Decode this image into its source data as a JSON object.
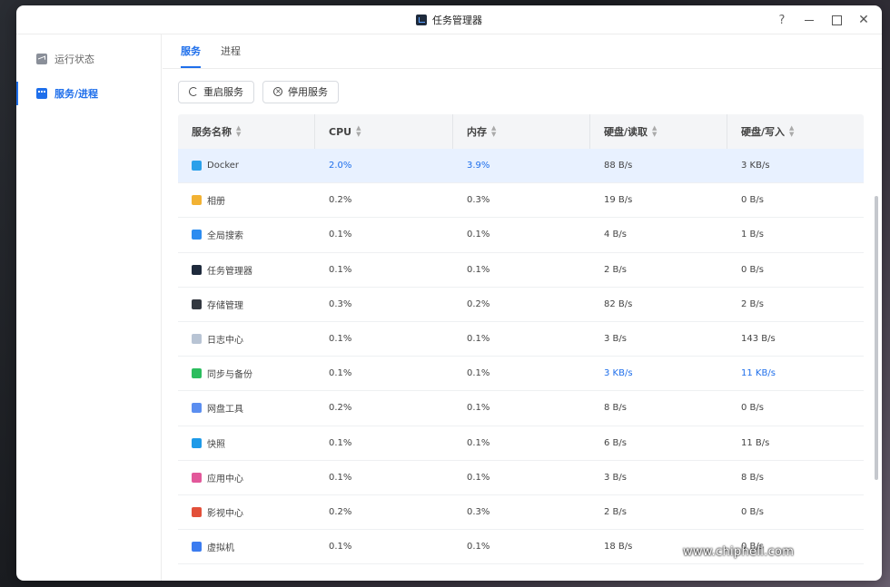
{
  "window": {
    "title": "任务管理器",
    "help": "?",
    "close_glyph": "✕"
  },
  "sidebar": {
    "items": [
      {
        "label": "运行状态",
        "active": false
      },
      {
        "label": "服务/进程",
        "active": true
      }
    ]
  },
  "tabs": [
    {
      "label": "服务",
      "active": true
    },
    {
      "label": "进程",
      "active": false
    }
  ],
  "toolbar": {
    "restart_label": "重启服务",
    "stop_label": "停用服务"
  },
  "table": {
    "columns": [
      "服务名称",
      "CPU",
      "内存",
      "硬盘/读取",
      "硬盘/写入"
    ],
    "rows": [
      {
        "icon": "docker-icon",
        "color": "#2aa0ea",
        "name": "Docker",
        "cpu": "2.0%",
        "mem": "3.9%",
        "read": "88 B/s",
        "write": "3 KB/s",
        "selected": true
      },
      {
        "icon": "photos-icon",
        "color": "#f2b233",
        "name": "相册",
        "cpu": "0.2%",
        "mem": "0.3%",
        "read": "19 B/s",
        "write": "0 B/s"
      },
      {
        "icon": "search-icon",
        "color": "#2c8cf0",
        "name": "全局搜索",
        "cpu": "0.1%",
        "mem": "0.1%",
        "read": "4 B/s",
        "write": "1 B/s"
      },
      {
        "icon": "task-manager-icon",
        "color": "#1e2a3c",
        "name": "任务管理器",
        "cpu": "0.1%",
        "mem": "0.1%",
        "read": "2 B/s",
        "write": "0 B/s"
      },
      {
        "icon": "storage-icon",
        "color": "#333840",
        "name": "存储管理",
        "cpu": "0.3%",
        "mem": "0.2%",
        "read": "82 B/s",
        "write": "2 B/s"
      },
      {
        "icon": "log-icon",
        "color": "#b8c4d4",
        "name": "日志中心",
        "cpu": "0.1%",
        "mem": "0.1%",
        "read": "3 B/s",
        "write": "143 B/s"
      },
      {
        "icon": "sync-icon",
        "color": "#2bbd5e",
        "name": "同步与备份",
        "cpu": "0.1%",
        "mem": "0.1%",
        "read": "3 KB/s",
        "write": "11 KB/s",
        "highlight": true
      },
      {
        "icon": "netdisk-icon",
        "color": "#5b8ef0",
        "name": "网盘工具",
        "cpu": "0.2%",
        "mem": "0.1%",
        "read": "8 B/s",
        "write": "0 B/s"
      },
      {
        "icon": "snapshot-icon",
        "color": "#1e9ae8",
        "name": "快照",
        "cpu": "0.1%",
        "mem": "0.1%",
        "read": "6 B/s",
        "write": "11 B/s"
      },
      {
        "icon": "app-center-icon",
        "color": "#e2589a",
        "name": "应用中心",
        "cpu": "0.1%",
        "mem": "0.1%",
        "read": "3 B/s",
        "write": "8 B/s"
      },
      {
        "icon": "video-icon",
        "color": "#e2503a",
        "name": "影视中心",
        "cpu": "0.2%",
        "mem": "0.3%",
        "read": "2 B/s",
        "write": "0 B/s"
      },
      {
        "icon": "vm-icon",
        "color": "#3b7cf0",
        "name": "虚拟机",
        "cpu": "0.1%",
        "mem": "0.1%",
        "read": "18 B/s",
        "write": "0 B/s"
      }
    ]
  },
  "watermark": "www.chiphell.com",
  "colors": {
    "accent": "#1f6feb",
    "selected_row": "#e8f1ff"
  }
}
